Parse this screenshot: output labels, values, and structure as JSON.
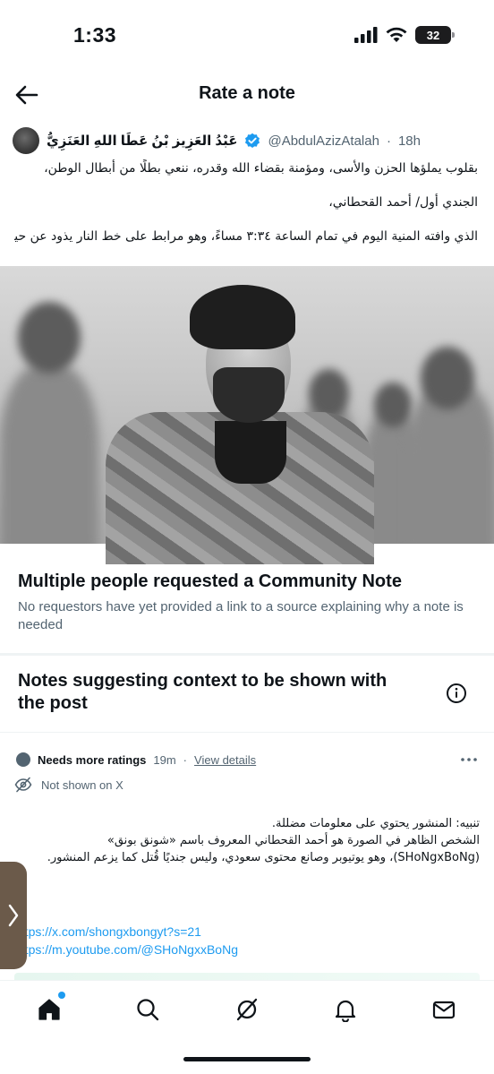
{
  "status_bar": {
    "time": "1:33",
    "battery": "32"
  },
  "header": {
    "title": "Rate a note"
  },
  "tweet": {
    "author_name": "عَبْدُ العَزِيز بْنُ عَطَا اللهِ العَنَزِيُّ",
    "handle": "@AbdulAzizAtalah",
    "separator": "·",
    "time": "18h",
    "lines": [
      "بقلوب يملؤها الحزن والأسى، ومؤمنة بقضاء الله وقدره، ننعي بطلًا من أبطال الوطن،",
      "الجندي أول/ أحمد القحطاني،",
      "الذي وافته المنية اليوم في تمام الساعة ٣:٣٤ مساءً، وهو مرابط على خط النار يذود عن حيا..."
    ]
  },
  "request": {
    "title": "Multiple people requested a Community Note",
    "description": "No requestors have yet provided a link to a source explaining why a note is needed"
  },
  "notes": {
    "title": "Notes suggesting context to be shown with the post"
  },
  "note": {
    "status": "Needs more ratings",
    "age": "19m",
    "separator": "·",
    "view_details": "View details",
    "shown_status": "Not shown on X",
    "body_lines": [
      "تنبيه: المنشور يحتوي على معلومات مضللة.",
      "الشخص الظاهر في الصورة هو أحمد القحطاني المعروف باسم «شونق بونق»",
      "(SHoNgxBoNg)، وهو يوتيوبر وصانع محتوى سعودي، وليس جنديًا قُتل كما يزعم المنشور."
    ],
    "links": [
      "https://x.com/shongxbongyt?s=21",
      "https://m.youtube.com/@SHoNgxxBoNg"
    ]
  },
  "colors": {
    "link": "#1d9bf0",
    "secondary_text": "#536471",
    "verified": "#1d9bf0"
  },
  "tab_bar": {
    "icons": [
      "home-icon",
      "search-icon",
      "grok-icon",
      "bell-icon",
      "mail-icon"
    ]
  }
}
